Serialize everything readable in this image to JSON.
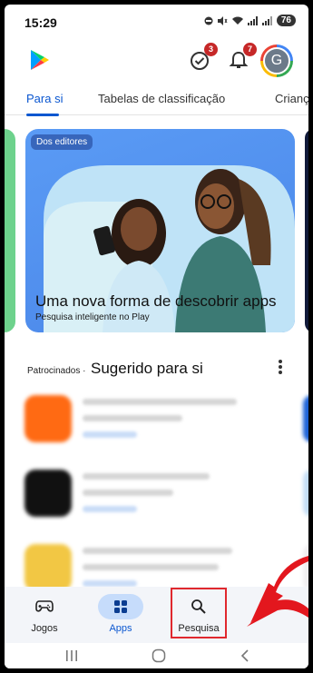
{
  "status": {
    "time": "15:29",
    "battery": "76"
  },
  "header": {
    "notifications_badge": "3",
    "alerts_badge": "7",
    "avatar_initial": "G"
  },
  "tabs": [
    {
      "label": "Para si",
      "active": true
    },
    {
      "label": "Tabelas de classificação",
      "active": false
    },
    {
      "label": "Crianças",
      "active": false
    }
  ],
  "hero": {
    "chip": "Dos editores",
    "title": "Uma nova forma de descobrir apps",
    "subtitle": "Pesquisa inteligente no Play"
  },
  "section": {
    "prefix": "Patrocinados ·",
    "title": "Sugerido para si"
  },
  "apps": [
    {
      "icon_color": "#ff6a13",
      "name_blurred": true
    },
    {
      "icon_color": "#111111",
      "name_blurred": true
    },
    {
      "icon_color": "#f2c744",
      "name_blurred": true
    }
  ],
  "bottom_nav": [
    {
      "label": "Jogos",
      "icon": "gamepad-icon",
      "active": false
    },
    {
      "label": "Apps",
      "icon": "apps-grid-icon",
      "active": true
    },
    {
      "label": "Pesquisa",
      "icon": "search-icon",
      "active": false,
      "highlighted": true
    }
  ],
  "colors": {
    "accent": "#0b57d0",
    "highlight": "#e0282e",
    "hero_bg": "#4a86e8"
  }
}
